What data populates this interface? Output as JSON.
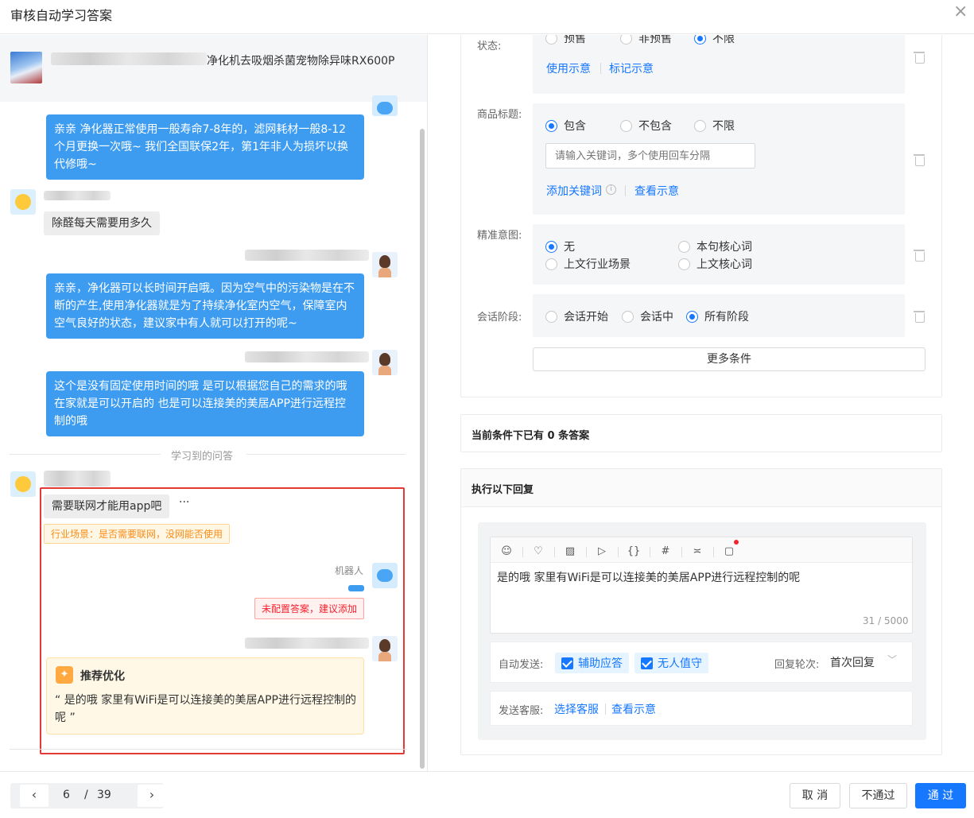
{
  "dialog": {
    "title": "审核自动学习答案",
    "close_icon": "×"
  },
  "product": {
    "name_visible": "净化机去吸烟杀菌宠物除异味RX600P"
  },
  "chat": {
    "msg1": "亲亲 净化器正常使用一般寿命7-8年的，滤网耗材一般8-12个月更换一次哦~ 我们全国联保2年，第1年非人为损坏以换代修哦~",
    "msg2": "除醛每天需要用多久",
    "msg3": "亲亲，净化器可以长时间开启哦。因为空气中的污染物是在不断的产生,使用净化器就是为了持续净化室内空气，保障室内空气良好的状态，建议家中有人就可以打开的呢~",
    "msg4": "这个是没有固定使用时间的哦 是可以根据您自己的需求的哦 在家就是可以开启的 也是可以连接美的美居APP进行远程控制的哦",
    "divider": "学习到的问答",
    "question": "需要联网才能用app吧",
    "more": "···",
    "scene_tag": "行业场景：是否需要联网，没网能否使用",
    "robot_name": "机器人",
    "no_answer_tag": "未配置答案，建议添加",
    "reco_title": "推荐优化",
    "reco_icon": "bulb-icon",
    "reco_text": "“ 是的哦 家里有WiFi是可以连接美的美居APP进行远程控制的呢 ”"
  },
  "conditions": {
    "status": {
      "label": "状态:",
      "options": [
        "预售",
        "非预售",
        "不限"
      ],
      "selected": "不限",
      "link1": "使用示意",
      "link2": "标记示意"
    },
    "title": {
      "label": "商品标题:",
      "options": [
        "包含",
        "不包含",
        "不限"
      ],
      "selected": "包含",
      "placeholder": "请输入关键词，多个使用回车分隔",
      "link1": "添加关键词",
      "link2": "查看示意"
    },
    "intent": {
      "label": "精准意图:",
      "options": [
        "无",
        "本句核心词",
        "上文行业场景",
        "上文核心词"
      ],
      "selected": "无"
    },
    "stage": {
      "label": "会话阶段:",
      "options": [
        "会话开始",
        "会话中",
        "所有阶段"
      ],
      "selected": "所有阶段"
    },
    "more_button": "更多条件"
  },
  "answers": {
    "count_text": "当前条件下已有 0 条答案"
  },
  "reply": {
    "title": "执行以下回复",
    "text": "是的哦 家里有WiFi是可以连接美的美居APP进行远程控制的呢",
    "counter": "31 / 5000",
    "toolbar": [
      "☺",
      "♡",
      "▨",
      "▷",
      "{}",
      "#",
      "≍",
      "▢"
    ],
    "auto_send_label": "自动发送:",
    "chk1": "辅助应答",
    "chk2": "无人值守",
    "rounds_label": "回复轮次:",
    "rounds_value": "首次回复",
    "send_agent_label": "发送客服:",
    "send_agent_link": "选择客服",
    "send_agent_link2": "查看示意"
  },
  "footer": {
    "page": "6",
    "slash": "/",
    "total": "39",
    "cancel": "取 消",
    "reject": "不通过",
    "approve": "通 过"
  },
  "colors": {
    "accent": "#1677ff",
    "bubble": "#3d9cf0",
    "danger": "#e53935",
    "warn": "#fa8c16"
  }
}
